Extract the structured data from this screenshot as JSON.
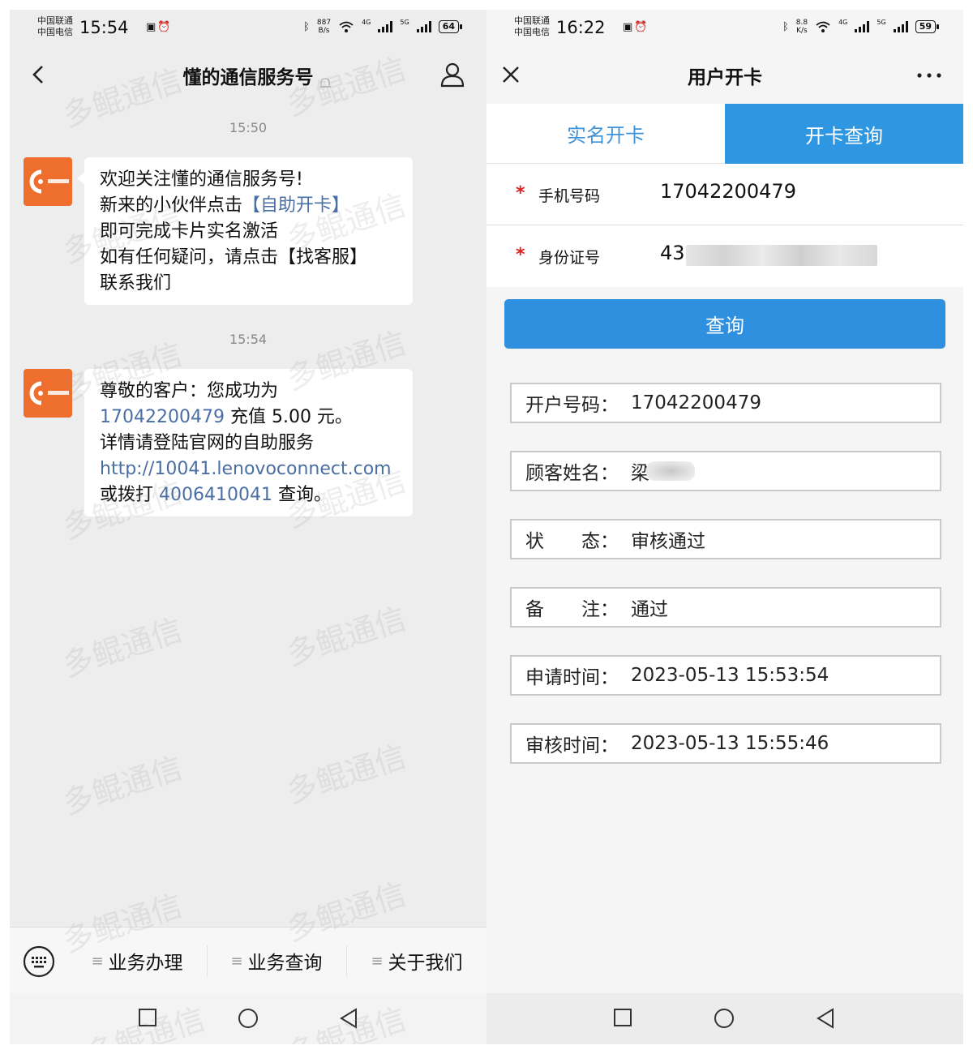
{
  "watermark": "多鲲通信",
  "left": {
    "status": {
      "carrier1": "中国联通",
      "carrier2": "中国电信",
      "time": "15:54",
      "net_speed_value": "887",
      "net_speed_unit": "B/s",
      "network1": "4G",
      "network2": "5G",
      "battery": "64"
    },
    "header": {
      "title": "懂的通信服务号"
    },
    "timestamps": [
      "15:50",
      "15:54"
    ],
    "message1": {
      "line1": "欢迎关注懂的通信服务号!",
      "line2_prefix": "新来的小伙伴点击",
      "line2_link": "【自助开卡】",
      "line3": "即可完成卡片实名激活",
      "line4": "如有任何疑问，请点击【找客服】",
      "line5": "联系我们"
    },
    "message2": {
      "line1": "尊敬的客户：您成功为",
      "number": "17042200479",
      "recharge_text": " 充值 5.00 元。",
      "line3": "详情请登陆官网的自助服务",
      "url": "http://10041.lenovoconnect.com",
      "dial_prefix": "或拨打 ",
      "hotline": "4006410041",
      "dial_suffix": " 查询。"
    },
    "menu": [
      "业务办理",
      "业务查询",
      "关于我们"
    ],
    "menu_icon": "≡"
  },
  "right": {
    "status": {
      "carrier1": "中国联通",
      "carrier2": "中国电信",
      "time": "16:22",
      "net_speed_value": "8.8",
      "net_speed_unit": "K/s",
      "network1": "4G",
      "network2": "5G",
      "battery": "59"
    },
    "header": {
      "title": "用户开卡"
    },
    "tabs": [
      "实名开卡",
      "开卡查询"
    ],
    "form": {
      "required_mark": "*",
      "phone_label": "手机号码",
      "phone_value": "17042200479",
      "id_label": "身份证号",
      "id_value_visible": "43"
    },
    "query_button": "查询",
    "results": [
      {
        "key": "开户号码：",
        "value": "17042200479"
      },
      {
        "key": "顾客姓名：",
        "value": "梁"
      },
      {
        "key": "状　　态：",
        "value": "审核通过"
      },
      {
        "key": "备　　注：",
        "value": "通过"
      },
      {
        "key": "申请时间：",
        "value": "2023-05-13 15:53:54"
      },
      {
        "key": "审核时间：",
        "value": "2023-05-13 15:55:46"
      }
    ]
  },
  "colors": {
    "accent_blue": "#2f90e0",
    "link_blue": "#4a6fa5",
    "avatar_orange": "#ee6f2d",
    "required_red": "#e02020"
  }
}
